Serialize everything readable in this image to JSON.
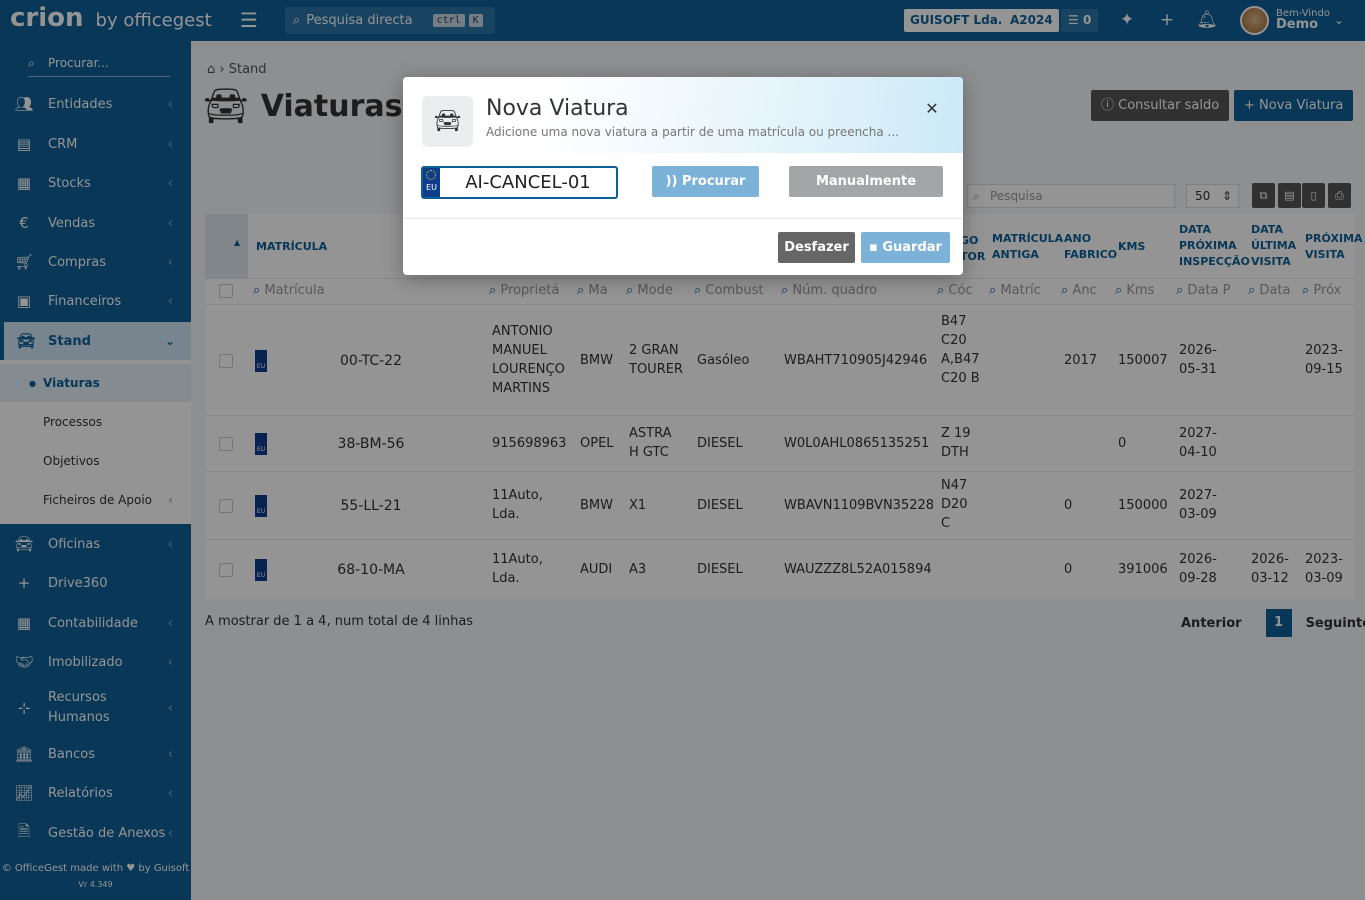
{
  "header": {
    "brand": "crion",
    "brand_sub": "by officegest",
    "search_placeholder": "Pesquisa directa",
    "shortcut_ctrl": "ctrl",
    "shortcut_key": "K",
    "company": "GUISOFT Lda.",
    "year": "A2024",
    "tasks_count": "0",
    "welcome": "Bem-Vindo",
    "username": "Demo"
  },
  "sidebar": {
    "search_placeholder": "Procurar...",
    "items": [
      {
        "label": "Entidades",
        "icon": "users-icon"
      },
      {
        "label": "CRM",
        "icon": "crm-icon"
      },
      {
        "label": "Stocks",
        "icon": "warehouse-icon"
      },
      {
        "label": "Vendas",
        "icon": "euro-icon"
      },
      {
        "label": "Compras",
        "icon": "cart-icon"
      },
      {
        "label": "Financeiros",
        "icon": "money-icon"
      },
      {
        "label": "Stand",
        "icon": "car-icon"
      },
      {
        "label": "Oficinas",
        "icon": "car-icon"
      },
      {
        "label": "Drive360",
        "icon": "plus-icon"
      },
      {
        "label": "Contabilidade",
        "icon": "calculator-icon"
      },
      {
        "label": "Imobilizado",
        "icon": "handshake-icon"
      },
      {
        "label": "Recursos Humanos",
        "icon": "sitemap-icon"
      },
      {
        "label": "Bancos",
        "icon": "bank-icon"
      },
      {
        "label": "Relatórios",
        "icon": "chart-icon"
      },
      {
        "label": "Gestão de Anexos",
        "icon": "file-icon"
      }
    ],
    "stand_sub": [
      "Viaturas",
      "Processos",
      "Objetivos",
      "Ficheiros de Apoio"
    ],
    "footer": "© OfficeGest made with ♥ by Guisoft",
    "version": "Vr 4.349"
  },
  "page": {
    "breadcrumb": "Stand",
    "title": "Viaturas",
    "btn_saldo": "Consultar saldo",
    "btn_nova": "Nova Viatura",
    "table_search_placeholder": "Pesquisa",
    "page_size": "50"
  },
  "table": {
    "headers": [
      "MATRÍCULA",
      "GO TOR",
      "MATRÍCULA ANTIGA",
      "ANO FABRICO",
      "KMS",
      "DATA PRÓXIMA INSPECÇÃO",
      "DATA ÚLTIMA VISITA",
      "PRÓXIMA VISITA"
    ],
    "filters": [
      "Matrícula",
      "Proprietá",
      "Ma",
      "Mode",
      "Combust",
      "Núm. quadro",
      "Cóc",
      "Matríc",
      "Anc",
      "Kms",
      "Data P",
      "Data",
      "Próx"
    ],
    "rows": [
      {
        "plate": "00-TC-22",
        "owner": "ANTONIO MANUEL LOURENÇO MARTINS",
        "brand": "BMW",
        "model": "2 GRAN TOURER",
        "fuel": "Gasóleo",
        "vin": "WBAHT710905J42946",
        "engine": "B47 C20 A,B47 C20 B",
        "old_plate": "",
        "year": "2017",
        "kms": "150007",
        "next_insp": "2026-05-31",
        "last_visit": "",
        "next_visit": "2023-09-15"
      },
      {
        "plate": "38-BM-56",
        "owner": "915698963",
        "brand": "OPEL",
        "model": "ASTRA H GTC",
        "fuel": "DIESEL",
        "vin": "W0L0AHL0865135251",
        "engine": "Z 19 DTH",
        "old_plate": "",
        "year": "",
        "kms": "0",
        "next_insp": "2027-04-10",
        "last_visit": "",
        "next_visit": ""
      },
      {
        "plate": "55-LL-21",
        "owner": "11Auto, Lda.",
        "brand": "BMW",
        "model": "X1",
        "fuel": "DIESEL",
        "vin": "WBAVN1109BVN35228",
        "engine": "N47 D20 C",
        "old_plate": "",
        "year": "0",
        "kms": "150000",
        "next_insp": "2027-03-09",
        "last_visit": "",
        "next_visit": ""
      },
      {
        "plate": "68-10-MA",
        "owner": "11Auto, Lda.",
        "brand": "AUDI",
        "model": "A3",
        "fuel": "DIESEL",
        "vin": "WAUZZZ8L52A015894",
        "engine": "",
        "old_plate": "",
        "year": "0",
        "kms": "391006",
        "next_insp": "2026-09-28",
        "last_visit": "2026-03-12",
        "next_visit": "2023-03-09"
      }
    ],
    "info": "A mostrar de 1 a 4, num total de 4 linhas",
    "prev": "Anterior",
    "current_page": "1",
    "next": "Seguinte"
  },
  "modal": {
    "title": "Nova Viatura",
    "subtitle": "Adicione uma nova viatura a partir de uma matrícula ou preencha ...",
    "plate_value": "AI-CANCEL-01",
    "eu_label": "EU",
    "btn_procurar": "Procurar",
    "btn_manual": "Manualmente",
    "btn_desfazer": "Desfazer",
    "btn_guardar": "Guardar"
  }
}
